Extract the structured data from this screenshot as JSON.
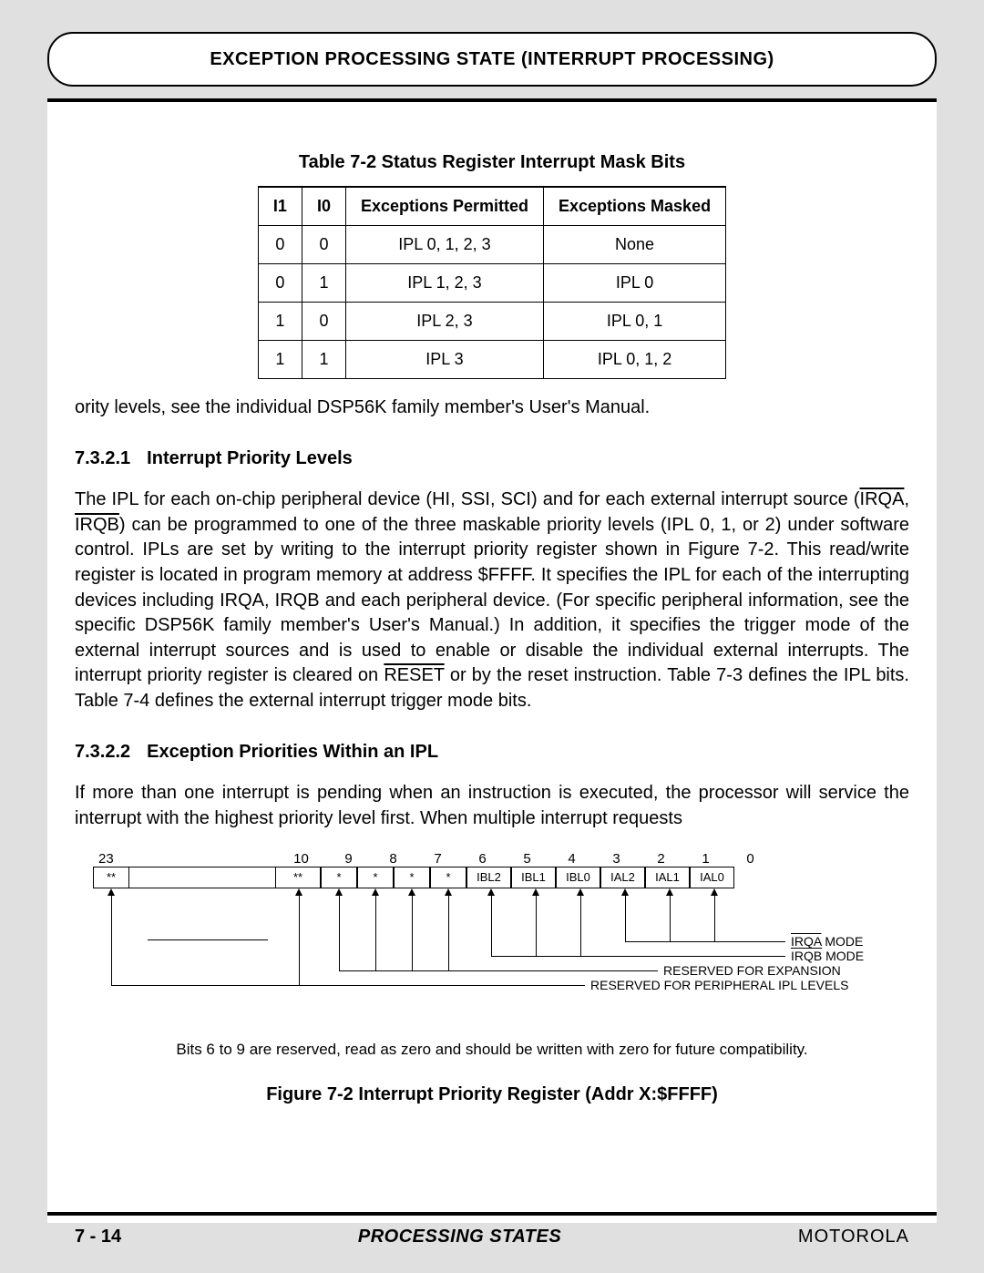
{
  "header": {
    "title": "EXCEPTION PROCESSING STATE (INTERRUPT PROCESSING)"
  },
  "table": {
    "caption": "Table 7-2 Status Register Interrupt Mask Bits",
    "headers": [
      "I1",
      "I0",
      "Exceptions Permitted",
      "Exceptions Masked"
    ],
    "rows": [
      [
        "0",
        "0",
        "IPL 0, 1, 2, 3",
        "None"
      ],
      [
        "0",
        "1",
        "IPL 1, 2, 3",
        "IPL 0"
      ],
      [
        "1",
        "0",
        "IPL 2, 3",
        "IPL 0, 1"
      ],
      [
        "1",
        "1",
        "IPL 3",
        "IPL 0, 1, 2"
      ]
    ]
  },
  "frag1": "ority levels, see the individual DSP56K family member's User's Manual.",
  "sec1": {
    "num": "7.3.2.1",
    "title": "Interrupt Priority Levels"
  },
  "para1a": "The IPL for each on-chip peripheral device (HI, SSI, SCI) and for each external interrupt source (",
  "para1b": ") can be programmed to one of the three maskable priority levels (IPL 0, 1, or 2) under software control. IPLs are set by writing to the interrupt priority register shown in Figure 7-2. This read/write register is located in program memory at address $FFFF. It specifies the IPL for each of the interrupting devices including IRQA, IRQB and each peripheral device. (For specific peripheral information, see the specific DSP56K family member's User's Manual.) In addition, it specifies the trigger mode of the external interrupt sources and is used to enable or disable the individual external interrupts. The interrupt priority register is cleared on ",
  "para1c": " or by the reset instruction. Table 7-3 defines the IPL bits. Table 7-4 defines the external interrupt trigger mode bits.",
  "ov": {
    "irqa": "IRQA",
    "irqb": "IRQB",
    "reset": "RESET"
  },
  "misc": {
    "comma_sp": ", "
  },
  "sec2": {
    "num": "7.3.2.2",
    "title": "Exception Priorities Within an IPL"
  },
  "para2": "If more than one interrupt is pending when an instruction is executed, the processor will service the interrupt with the highest priority level first. When multiple interrupt requests",
  "chart_data": {
    "type": "table",
    "title": "Interrupt Priority Register bit layout",
    "bit_numbers": [
      "23",
      "10",
      "9",
      "8",
      "7",
      "6",
      "5",
      "4",
      "3",
      "2",
      "1",
      "0"
    ],
    "cells": [
      "**",
      "",
      "**",
      "*",
      "*",
      "*",
      "*",
      "IBL2",
      "IBL1",
      "IBL0",
      "IAL2",
      "IAL1",
      "IAL0"
    ],
    "callouts": [
      {
        "text_prefix_ov": "IRQA",
        "text_suffix": " MODE"
      },
      {
        "text_prefix_ov": "IRQB",
        "text_suffix": " MODE"
      },
      {
        "text": "RESERVED FOR EXPANSION"
      },
      {
        "text": "RESERVED FOR PERIPHERAL IPL LEVELS"
      }
    ]
  },
  "fig": {
    "note": "Bits 6 to 9 are reserved, read as zero and should be written with zero for future compatibility.",
    "caption": "Figure  7-2  Interrupt Priority Register (Addr X:$FFFF)"
  },
  "footer": {
    "page": "7 - 14",
    "center": "PROCESSING STATES",
    "brand": "MOTOROLA"
  }
}
